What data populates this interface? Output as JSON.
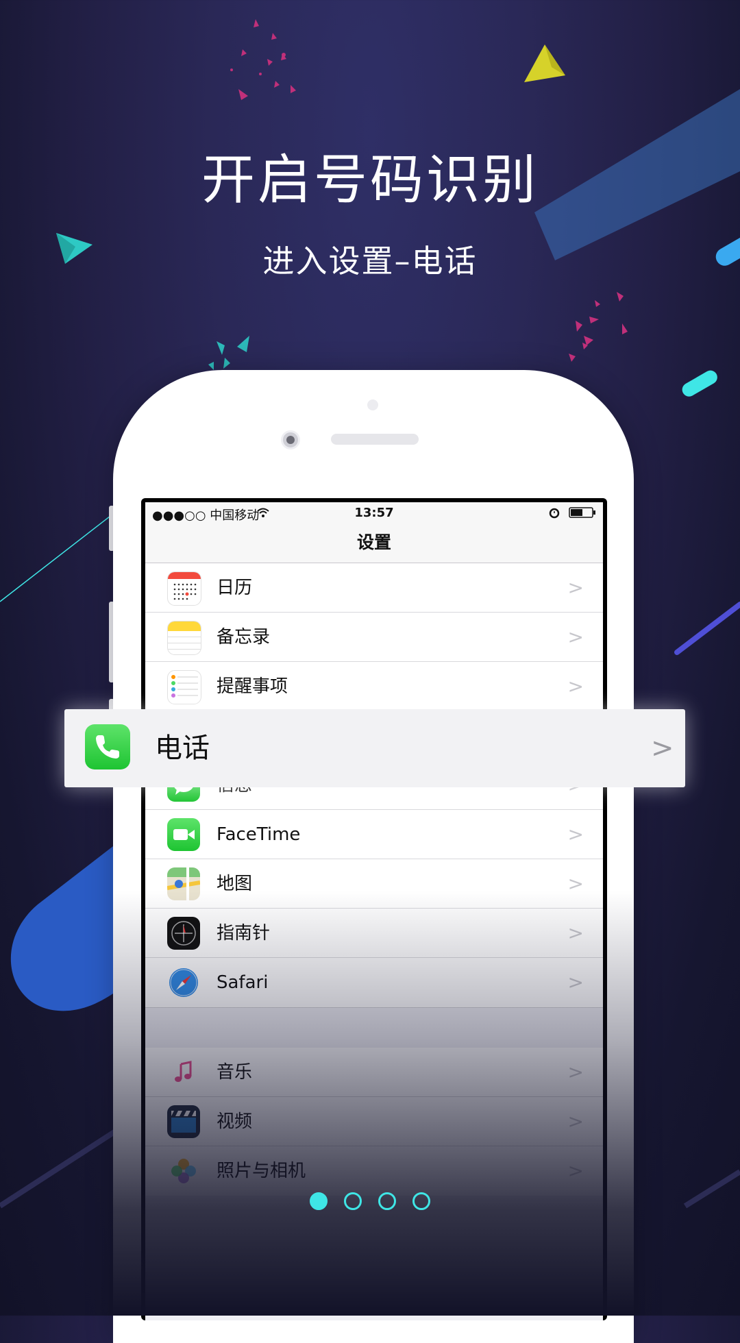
{
  "header": {
    "title": "开启号码识别",
    "subtitle": "进入设置–电话"
  },
  "statusbar": {
    "carrier": "●●●○○ 中国移动",
    "time": "13:57"
  },
  "settings": {
    "nav_title": "设置",
    "rows": [
      {
        "label": "日历",
        "icon": "calendar-icon"
      },
      {
        "label": "备忘录",
        "icon": "notes-icon"
      },
      {
        "label": "提醒事项",
        "icon": "reminders-icon"
      },
      {
        "label": "电话",
        "icon": "phone-icon"
      },
      {
        "label": "信息",
        "icon": "messages-icon"
      },
      {
        "label": "FaceTime",
        "icon": "facetime-icon"
      },
      {
        "label": "地图",
        "icon": "maps-icon"
      },
      {
        "label": "指南针",
        "icon": "compass-icon"
      },
      {
        "label": "Safari",
        "icon": "safari-icon"
      }
    ],
    "rows2": [
      {
        "label": "音乐",
        "icon": "music-icon"
      },
      {
        "label": "视频",
        "icon": "videos-icon"
      },
      {
        "label": "照片与相机",
        "icon": "photos-icon"
      }
    ]
  },
  "highlight": {
    "label": "电话",
    "icon": "phone-icon"
  },
  "pager": {
    "count": 4,
    "active_index": 0
  },
  "colors": {
    "accent": "#3fe6e6",
    "phone_green": "#2fd158",
    "background": "#2a2857"
  }
}
